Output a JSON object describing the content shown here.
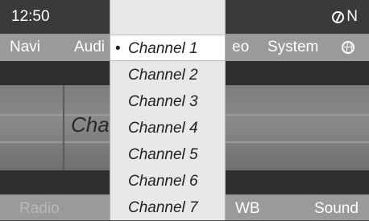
{
  "status": {
    "time": "12:50",
    "heading": "N"
  },
  "menu": [
    "Navi",
    "Audi",
    "eo",
    "System"
  ],
  "display": {
    "channel_fragment": "Cha"
  },
  "bottom_menu": [
    "Radio",
    "WB",
    "Sound"
  ],
  "channels": {
    "selected_marker": "•",
    "items": [
      "Channel 1",
      "Channel 2",
      "Channel 3",
      "Channel 4",
      "Channel 5",
      "Channel 6",
      "Channel 7"
    ],
    "selected_index": 0
  },
  "icons": {
    "compass": "compass-icon",
    "globe": "globe-icon"
  }
}
